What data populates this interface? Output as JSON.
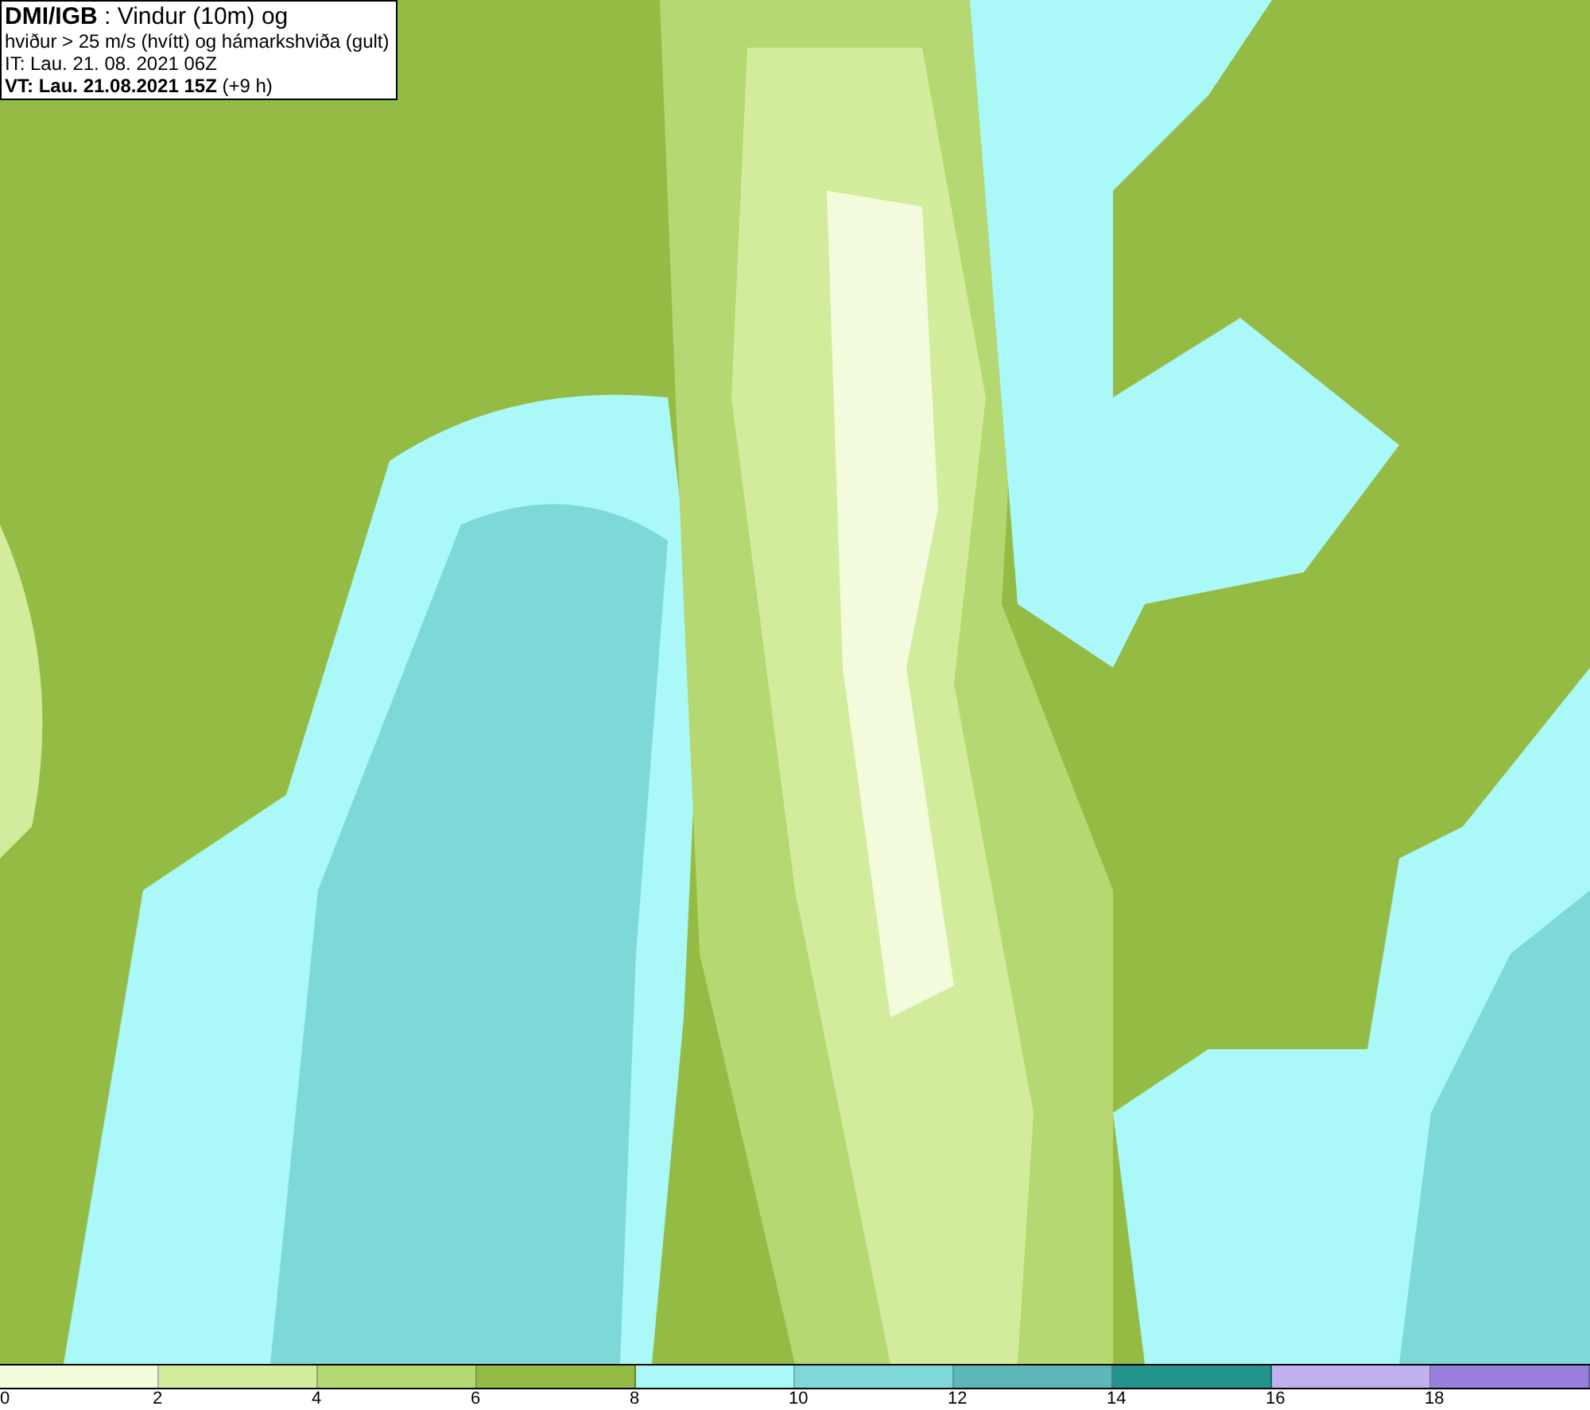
{
  "info_box": {
    "lines": [
      "**DMI/IGB** : Vindur (10m) og",
      "hviður > 25 m/s (hvítt) og hámarkshviða (gult)",
      "IT: Lau. 21. 08. 2021 06Z",
      "**VT: Lau. 21.08.2021 15Z** (+9 h)"
    ]
  },
  "legend": {
    "swatches": [
      {
        "color": "#f2fcdc"
      },
      {
        "color": "#d3ec9c"
      },
      {
        "color": "#b5d872"
      },
      {
        "color": "#94bc45"
      },
      {
        "color": "#aaf8f8"
      },
      {
        "color": "#7ed8d8"
      },
      {
        "color": "#5cb8b8"
      },
      {
        "color": "#22948c"
      },
      {
        "color": "#c0b0f0"
      },
      {
        "color": "#9880dc"
      }
    ],
    "ticks": [
      "0",
      "2",
      "4",
      "6",
      "8",
      "10",
      "12",
      "14",
      "16",
      "18"
    ]
  }
}
